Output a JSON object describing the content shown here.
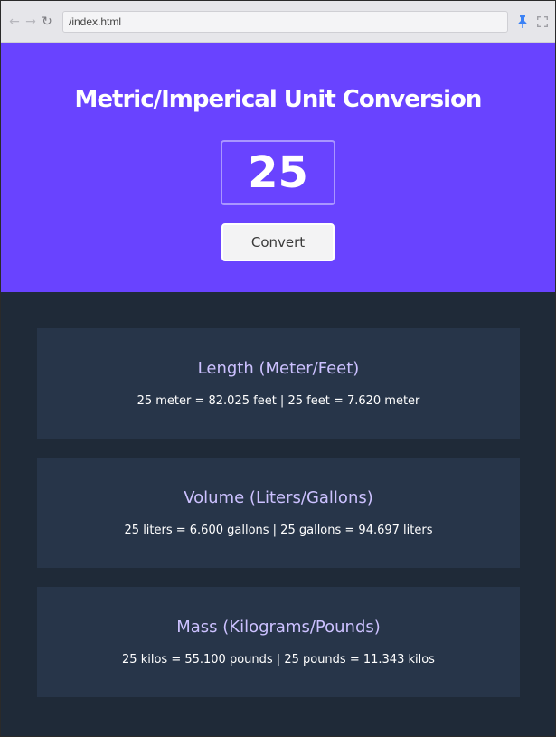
{
  "browser": {
    "url": "/index.html",
    "icons": {
      "back": "arrow-left-icon",
      "forward": "arrow-right-icon",
      "reload": "reload-icon",
      "pin": "pin-icon",
      "fullscreen": "expand-icon"
    }
  },
  "hero": {
    "title": "Metric/Imperical Unit Conversion",
    "input_value": "25",
    "convert_label": "Convert"
  },
  "cards": [
    {
      "title": "Length (Meter/Feet)",
      "result": "25 meter = 82.025 feet | 25 feet = 7.620 meter"
    },
    {
      "title": "Volume (Liters/Gallons)",
      "result": "25 liters = 6.600 gallons | 25 gallons = 94.697 liters"
    },
    {
      "title": "Mass (Kilograms/Pounds)",
      "result": "25 kilos = 55.100 pounds | 25 pounds = 11.343 kilos"
    }
  ],
  "colors": {
    "hero_bg": "#6943ff",
    "page_bg": "#1f2a38",
    "card_bg": "#273549",
    "card_title": "#ccc1ff",
    "pin_accent": "#3b82f6"
  }
}
